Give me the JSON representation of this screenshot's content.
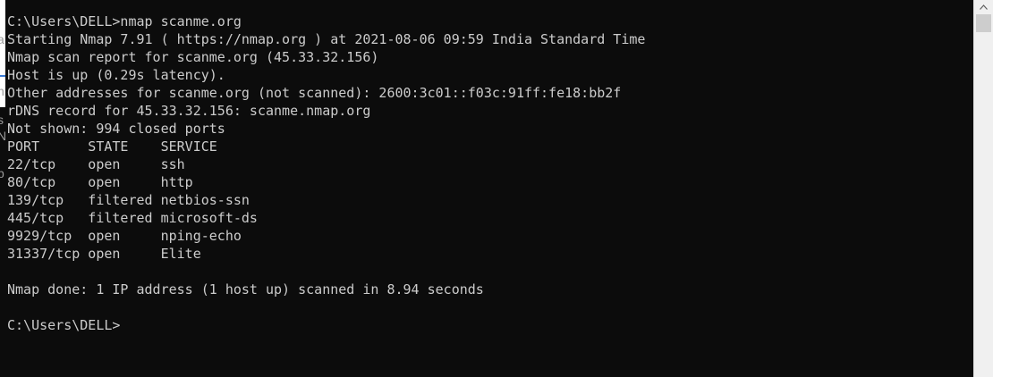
{
  "terminal": {
    "lines": [
      "C:\\Users\\DELL>nmap scanme.org",
      "Starting Nmap 7.91 ( https://nmap.org ) at 2021-08-06 09:59 India Standard Time",
      "Nmap scan report for scanme.org (45.33.32.156)",
      "Host is up (0.29s latency).",
      "Other addresses for scanme.org (not scanned): 2600:3c01::f03c:91ff:fe18:bb2f",
      "rDNS record for 45.33.32.156: scanme.nmap.org",
      "Not shown: 994 closed ports",
      "PORT      STATE    SERVICE",
      "22/tcp    open     ssh",
      "80/tcp    open     http",
      "139/tcp   filtered netbios-ssn",
      "445/tcp   filtered microsoft-ds",
      "9929/tcp  open     nping-echo",
      "31337/tcp open     Elite",
      "",
      "Nmap done: 1 IP address (1 host up) scanned in 8.94 seconds",
      "",
      "C:\\Users\\DELL>"
    ]
  },
  "behind_window": {
    "fragments": [
      "l",
      "a",
      "n",
      "s",
      "N",
      "p"
    ]
  },
  "colors": {
    "terminal_bg": "#0c0c0c",
    "terminal_text": "#cccccc",
    "scrollbar_bg": "#f0f0f0",
    "scrollbar_thumb": "#cdcdcd"
  },
  "icons": {
    "scroll_up": "chevron-up-icon"
  }
}
